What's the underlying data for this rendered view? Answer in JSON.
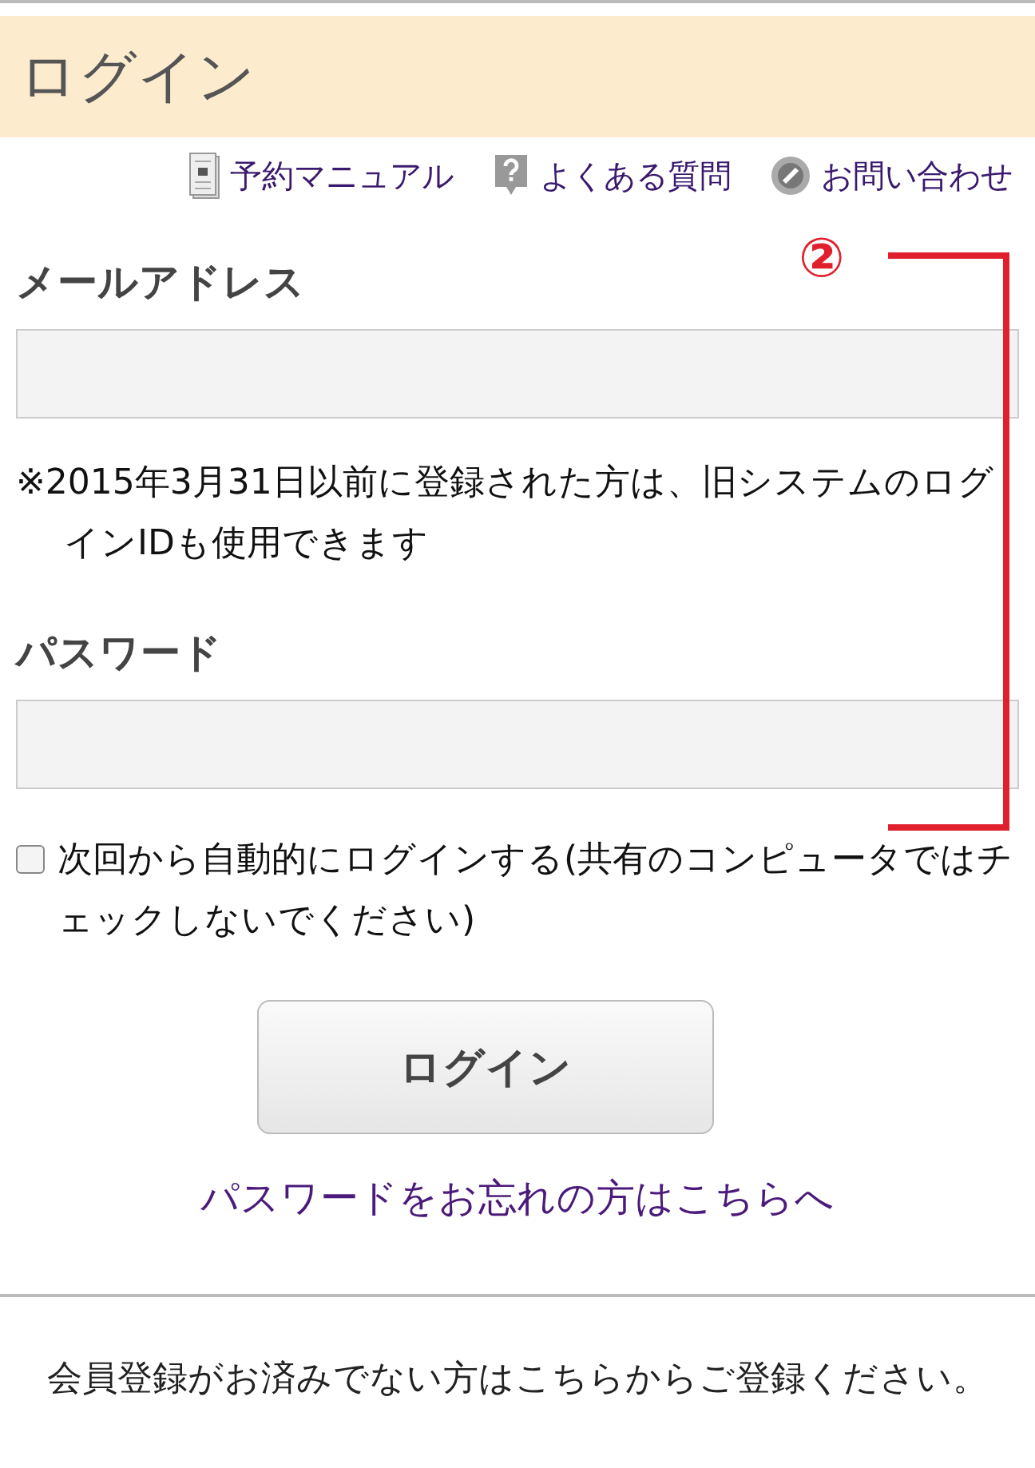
{
  "header": {
    "title": "ログイン"
  },
  "links": [
    {
      "kind": "manual",
      "label": "予約マニュアル"
    },
    {
      "kind": "faq",
      "label": "よくある質問"
    },
    {
      "kind": "contact",
      "label": "お問い合わせ"
    }
  ],
  "email": {
    "label": "メールアドレス"
  },
  "note": "※2015年3月31日以前に登録された方は、旧システムのログインIDも使用できます",
  "password": {
    "label": "パスワード"
  },
  "remember": {
    "label": "次回から自動的にログインする(共有のコンピュータではチェックしないでください)",
    "checked": false
  },
  "login_button": "ログイン",
  "forgot_link": "パスワードをお忘れの方はこちらへ",
  "register_text": "会員登録がお済みでない方はこちらからご登録ください。",
  "annotation": {
    "label": "②"
  }
}
